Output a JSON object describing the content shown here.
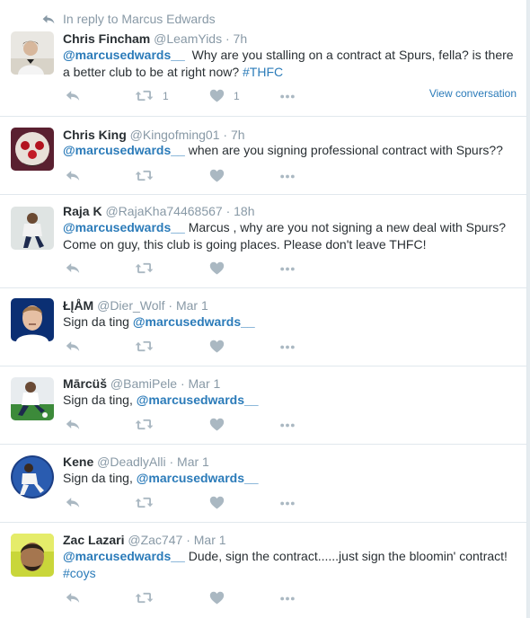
{
  "reply_context": "In reply to Marcus Edwards",
  "view_conversation": "View conversation",
  "icons": [
    "reply-icon",
    "retweet-icon",
    "like-icon",
    "more-icon"
  ],
  "colors": {
    "link": "#2b7bb9",
    "muted": "#8899a6",
    "icon": "#aab8c2",
    "divider": "#e1e8ed"
  },
  "tweets": [
    {
      "fullname": "Chris Fincham",
      "username": "@LeamYids",
      "time": "7h",
      "mention": "@marcusedwards__",
      "text": "  Why are you stalling on a contract at Spurs, fella? is there a better club to be at right now? ",
      "hashtag": "#THFC",
      "retweets": "1",
      "likes": "1"
    },
    {
      "fullname": "Chris King",
      "username": "@Kingofming01",
      "time": "7h",
      "mention": "@marcusedwards__",
      "text": " when are you signing professional contract with Spurs??"
    },
    {
      "fullname": "Raja K",
      "username": "@RajaKha74468567",
      "time": "18h",
      "mention": "@marcusedwards__",
      "text": " Marcus , why are you not signing a new deal with Spurs? Come on guy, this club is going places. Please don't leave THFC!"
    },
    {
      "fullname": "ŁĮÅM",
      "username": "@Dier_Wolf",
      "time": "Mar 1",
      "prefix": "Sign da ting ",
      "mention": "@marcusedwards__"
    },
    {
      "fullname": "Mārcüš",
      "username": "@BamiPele",
      "time": "Mar 1",
      "prefix": "Sign da ting, ",
      "mention": "@marcusedwards__"
    },
    {
      "fullname": "Kene",
      "username": "@DeadlyAlli",
      "time": "Mar 1",
      "prefix": "Sign da ting, ",
      "mention": "@marcusedwards__"
    },
    {
      "fullname": "Zac Lazari",
      "username": "@Zac747",
      "time": "Mar 1",
      "mention": "@marcusedwards__",
      "text": " Dude, sign the contract......just sign the bloomin' contract! ",
      "hashtag": "#coys"
    }
  ]
}
